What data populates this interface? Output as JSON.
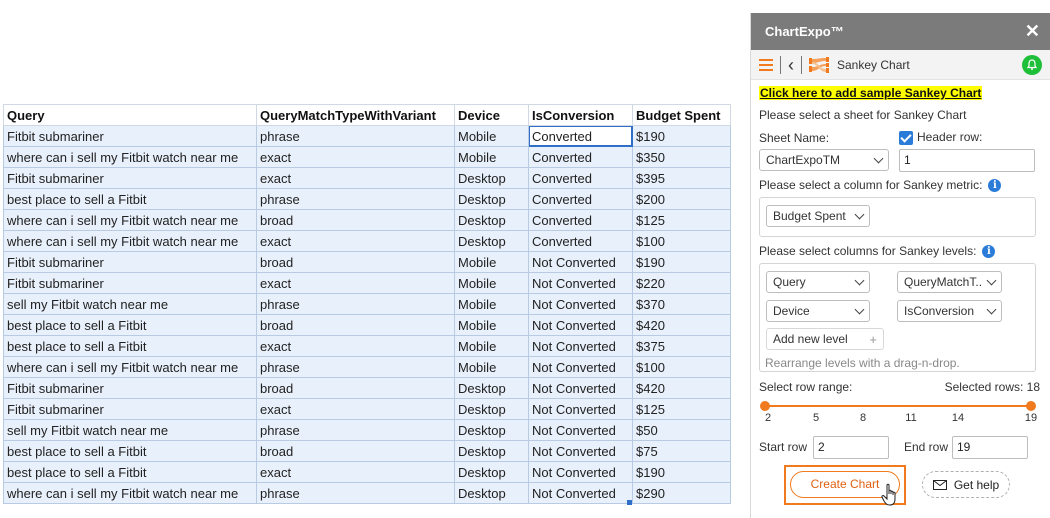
{
  "sheet": {
    "columns": [
      "Query",
      "QueryMatchTypeWithVariant",
      "Device",
      "IsConversion",
      "Budget Spent"
    ],
    "rows": [
      [
        "Fitbit submariner",
        "phrase",
        "Mobile",
        "Converted",
        "$190"
      ],
      [
        "where can i sell my Fitbit watch near me",
        "exact",
        "Mobile",
        "Converted",
        "$350"
      ],
      [
        "Fitbit submariner",
        "exact",
        "Desktop",
        "Converted",
        "$395"
      ],
      [
        "best place to sell a Fitbit",
        "phrase",
        "Desktop",
        "Converted",
        "$200"
      ],
      [
        "where can i sell my Fitbit watch near me",
        "broad",
        "Desktop",
        "Converted",
        "$125"
      ],
      [
        "where can i sell my Fitbit watch near me",
        "exact",
        "Desktop",
        "Converted",
        "$100"
      ],
      [
        "Fitbit submariner",
        "broad",
        "Mobile",
        "Not Converted",
        "$190"
      ],
      [
        "Fitbit submariner",
        "exact",
        "Mobile",
        "Not Converted",
        "$220"
      ],
      [
        "sell my Fitbit watch near me",
        "phrase",
        "Mobile",
        "Not Converted",
        "$370"
      ],
      [
        "best place to sell a Fitbit",
        "broad",
        "Mobile",
        "Not Converted",
        "$420"
      ],
      [
        "best place to sell a Fitbit",
        "exact",
        "Mobile",
        "Not Converted",
        "$375"
      ],
      [
        "where can i sell my Fitbit watch near me",
        "phrase",
        "Mobile",
        "Not Converted",
        "$100"
      ],
      [
        "Fitbit submariner",
        "broad",
        "Desktop",
        "Not Converted",
        "$420"
      ],
      [
        "Fitbit submariner",
        "exact",
        "Desktop",
        "Not Converted",
        "$125"
      ],
      [
        "sell my Fitbit watch near me",
        "phrase",
        "Desktop",
        "Not Converted",
        "$50"
      ],
      [
        "best place to sell a Fitbit",
        "broad",
        "Desktop",
        "Not Converted",
        "$75"
      ],
      [
        "best place to sell a Fitbit",
        "exact",
        "Desktop",
        "Not Converted",
        "$190"
      ],
      [
        "where can i sell my Fitbit watch near me",
        "phrase",
        "Desktop",
        "Not Converted",
        "$290"
      ]
    ]
  },
  "pane": {
    "title": "ChartExpo™",
    "close_label": "✕",
    "chart_label": "Sankey Chart",
    "sample_link": "Click here to add sample Sankey Chart",
    "select_sheet_prompt": "Please select a sheet for Sankey Chart",
    "sheet_name_label": "Sheet Name:",
    "sheet_name_value": "ChartExpoTM",
    "header_row_label": "Header row:",
    "header_row_value": "1",
    "metric_prompt": "Please select a column for Sankey metric:",
    "metric_value": "Budget Spent",
    "levels_prompt": "Please select columns for Sankey levels:",
    "levels": [
      "Query",
      "QueryMatchT...",
      "Device",
      "IsConversion"
    ],
    "add_level_label": "Add new level",
    "add_level_plus": "+",
    "rearrange_hint": "Rearrange levels with a drag-n-drop.",
    "row_range_label": "Select row range:",
    "selected_rows_label": "Selected rows: 18",
    "range_ticks": [
      "2",
      "5",
      "8",
      "11",
      "14",
      "19"
    ],
    "range_start": 2,
    "range_end": 19,
    "start_row_label": "Start row",
    "start_row_value": "2",
    "end_row_label": "End row",
    "end_row_value": "19",
    "create_button": "Create Chart",
    "help_button": "Get help",
    "info_glyph": "i"
  },
  "colors": {
    "accent": "#f07a1d",
    "header_bar": "#7b7b7b",
    "selection": "#2f6fc7",
    "info_blue": "#2b7cd8",
    "notify_green": "#1fbf3a",
    "link_highlight": "#ffff00"
  },
  "icons": [
    "close-icon",
    "hamburger-icon",
    "back-icon",
    "sankey-chart-icon",
    "bell-icon",
    "info-icon",
    "checkbox-icon",
    "chevron-down-icon",
    "plus-icon",
    "envelope-icon",
    "hand-cursor-icon"
  ]
}
